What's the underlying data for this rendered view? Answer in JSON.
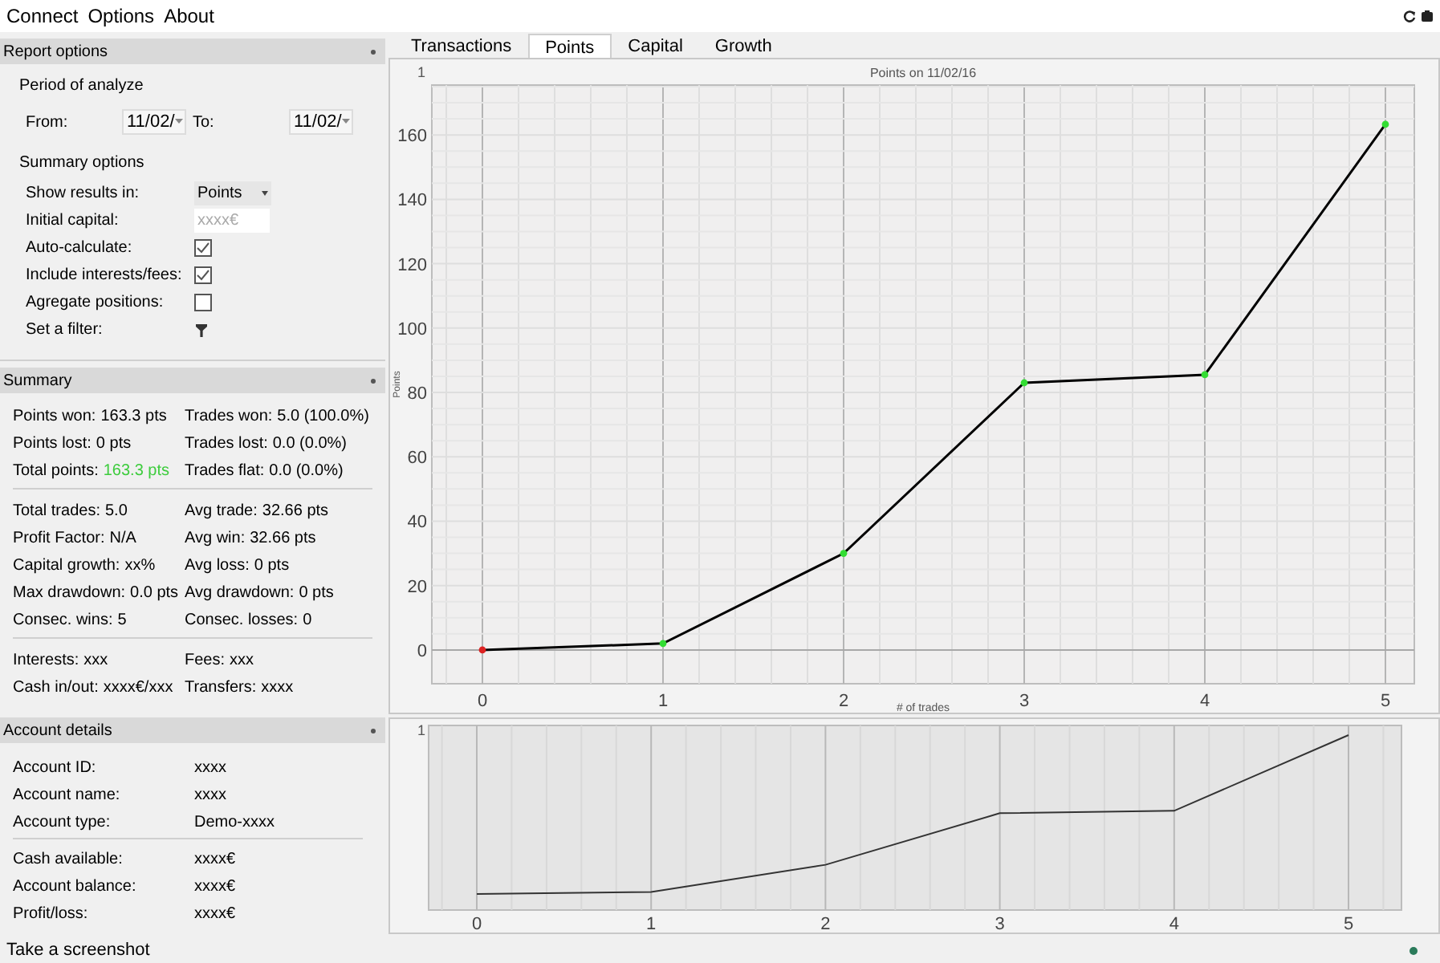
{
  "menu": [
    "Connect",
    "Options",
    "About"
  ],
  "report_options": {
    "title": "Report options",
    "period_title": "Period of analyze",
    "from_label": "From:",
    "from_value": "11/02/",
    "to_label": "To:",
    "to_value": "11/02/",
    "summary_title": "Summary options",
    "rows": [
      {
        "kind": "select",
        "label": "Show results in:",
        "value": "Points"
      },
      {
        "kind": "input",
        "label": "Initial capital:",
        "placeholder": "xxxx€"
      },
      {
        "kind": "checkbox",
        "label": "Auto-calculate:",
        "checked": true
      },
      {
        "kind": "checkbox",
        "label": "Include interests/fees:",
        "checked": true
      },
      {
        "kind": "checkbox",
        "label": "Agregate positions:",
        "checked": false
      },
      {
        "kind": "filter",
        "label": "Set a filter:"
      }
    ]
  },
  "summary": {
    "title": "Summary",
    "groups": [
      [
        {
          "left": {
            "label": "Points won:",
            "value": "163.3 pts",
            "positive": false
          },
          "right": {
            "label": "Trades won:",
            "value": "5.0 (100.0%)",
            "positive": false
          }
        },
        {
          "left": {
            "label": "Points lost:",
            "value": "0 pts",
            "positive": false
          },
          "right": {
            "label": "Trades lost:",
            "value": "0.0 (0.0%)",
            "positive": false
          }
        },
        {
          "left": {
            "label": "Total points:",
            "value": "163.3 pts",
            "positive": true
          },
          "right": {
            "label": "Trades flat:",
            "value": "0.0 (0.0%)",
            "positive": false
          }
        }
      ],
      [
        {
          "left": {
            "label": "Total trades:",
            "value": "5.0",
            "positive": false
          },
          "right": {
            "label": "Avg trade:",
            "value": "32.66 pts",
            "positive": false
          }
        },
        {
          "left": {
            "label": "Profit Factor:",
            "value": "N/A",
            "positive": false
          },
          "right": {
            "label": "Avg win:",
            "value": "32.66 pts",
            "positive": false
          }
        },
        {
          "left": {
            "label": "Capital growth:",
            "value": "xx%",
            "positive": false
          },
          "right": {
            "label": "Avg loss:",
            "value": "0 pts",
            "positive": false
          }
        },
        {
          "left": {
            "label": "Max drawdown:",
            "value": "0.0 pts",
            "positive": false
          },
          "right": {
            "label": "Avg drawdown:",
            "value": "0 pts",
            "positive": false
          }
        },
        {
          "left": {
            "label": "Consec. wins:",
            "value": "5",
            "positive": false
          },
          "right": {
            "label": "Consec. losses:",
            "value": "0",
            "positive": false
          }
        }
      ],
      [
        {
          "left": {
            "label": "Interests:",
            "value": "xxx",
            "positive": false
          },
          "right": {
            "label": "Fees:",
            "value": "xxx",
            "positive": false
          }
        },
        {
          "left": {
            "label": "Cash in/out:",
            "value": "xxxx€/xxx",
            "positive": false
          },
          "right": {
            "label": "Transfers:",
            "value": "xxxx",
            "positive": false
          }
        }
      ]
    ]
  },
  "account": {
    "title": "Account details",
    "groups": [
      [
        {
          "label": "Account ID:",
          "value": "xxxx"
        },
        {
          "label": "Account name:",
          "value": "xxxx"
        },
        {
          "label": "Account type:",
          "value": "Demo-xxxx"
        }
      ],
      [
        {
          "label": "Cash available:",
          "value": "xxxx€"
        },
        {
          "label": "Account balance:",
          "value": "xxxx€"
        },
        {
          "label": "Profit/loss:",
          "value": "xxxx€"
        }
      ]
    ]
  },
  "status_bar": {
    "text": "Take a screenshot"
  },
  "tabs": [
    {
      "label": "Transactions",
      "selected": false
    },
    {
      "label": "Points",
      "selected": true
    },
    {
      "label": "Capital",
      "selected": false
    },
    {
      "label": "Growth",
      "selected": false
    }
  ],
  "chart": {
    "corner_label": "1",
    "chart_data": {
      "type": "line",
      "title": "Points on 11/02/16",
      "xlabel": "# of trades",
      "ylabel": "Points",
      "x": [
        0,
        1,
        2,
        3,
        4,
        5
      ],
      "series": [
        {
          "color": "#000000",
          "marker": "circle",
          "values": [
            0,
            2,
            30,
            83,
            85.5,
            163.3
          ]
        }
      ],
      "grid": true,
      "xlim": [
        -0.28,
        5.16
      ],
      "ylim": [
        -10.5,
        175.5
      ],
      "xticks": [
        0,
        1,
        2,
        3,
        4,
        5
      ],
      "yticks": [
        0,
        20,
        40,
        60,
        80,
        100,
        120,
        140,
        160
      ]
    }
  },
  "overview": {
    "corner_label": "1",
    "xticks": [
      "0",
      "1",
      "2",
      "3",
      "4",
      "5"
    ]
  }
}
